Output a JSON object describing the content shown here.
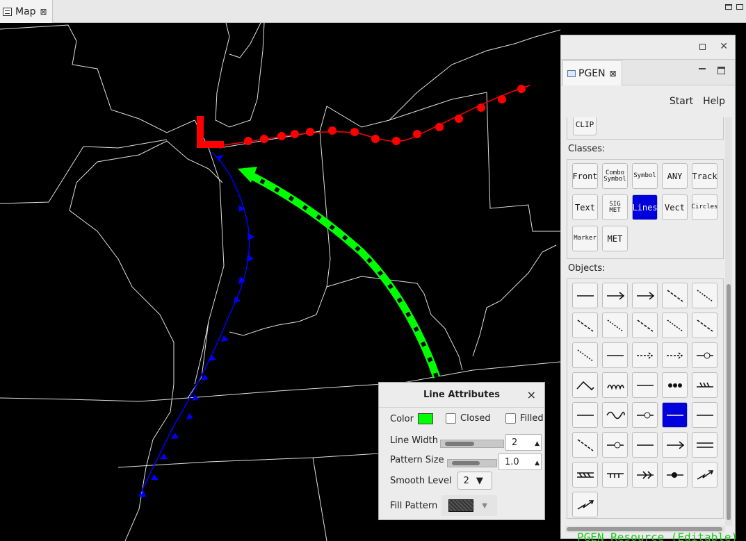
{
  "top_tab": {
    "label": "Map",
    "close_glyph": "⊠"
  },
  "pgen": {
    "tab_label": "PGEN",
    "tab_close_glyph": "⊠",
    "window_close_glyph": "✕",
    "menu": {
      "start": "Start",
      "help": "Help"
    },
    "clip_label": "CLIP",
    "classes_label": "Classes:",
    "classes": [
      {
        "label": "Front",
        "icon": "front-class"
      },
      {
        "label": "Combo Symbol",
        "icon": "combo-symbol-class"
      },
      {
        "label": "Symbol",
        "icon": "symbol-class"
      },
      {
        "label": "ANY",
        "icon": "any-class"
      },
      {
        "label": "Track",
        "icon": "track-class"
      },
      {
        "label": "Text",
        "icon": "text-class"
      },
      {
        "label": "SIG MET",
        "icon": "sigmet-class"
      },
      {
        "label": "Lines",
        "icon": "lines-class",
        "selected": true
      },
      {
        "label": "Vect",
        "icon": "vector-class"
      },
      {
        "label": "Circles",
        "icon": "circles-class"
      },
      {
        "label": "Marker",
        "icon": "marker-class"
      },
      {
        "label": "MET",
        "icon": "met-class"
      }
    ],
    "objects_label": "Objects:",
    "objects": [
      "solid-line",
      "arrow-line",
      "filled-arrow-line",
      "dotted-line",
      "dashed-line",
      "dash-line-2",
      "dash-line-3",
      "dash-line-4",
      "dash-dot-line",
      "dash-line-5",
      "dotted-dash-line",
      "dash-dot-line-2",
      "dashed-arrow-line",
      "dashed-filled-arrow-line",
      "circle-line",
      "zigzag-line",
      "scallop-line",
      "cross-arrow-line",
      "dots-line",
      "double-tick-line",
      "tick-line",
      "wave-line",
      "box-circle-line",
      "selected-arrow-line",
      "x-line",
      "x-dash-line",
      "circle-x-line",
      "box-x-line",
      "circle-arrow-line",
      "double-line",
      "zigzag-fill-line",
      "tick-bar-line",
      "double-arrow-line",
      "filled-diamond-arrow-line",
      "squiggle-arrow-line",
      "thick-arrow-line"
    ]
  },
  "status_text": "PGEN Resource (Editable)",
  "line_attributes": {
    "title": "Line Attributes",
    "close_glyph": "×",
    "color_label": "Color",
    "color_value": "#00ff00",
    "closed_label": "Closed",
    "filled_label": "Filled",
    "line_width_label": "Line Width",
    "line_width_value": "2",
    "pattern_size_label": "Pattern Size",
    "pattern_size_value": "1.0",
    "smooth_level_label": "Smooth Level",
    "smooth_level_value": "2",
    "fill_pattern_label": "Fill Pattern"
  },
  "colors": {
    "warm_front": "#ff0000",
    "cold_front": "#0000ff",
    "drawn_arrow": "#00ff00",
    "low_marker": "#ff0000",
    "selected_class": "#0000dd"
  }
}
